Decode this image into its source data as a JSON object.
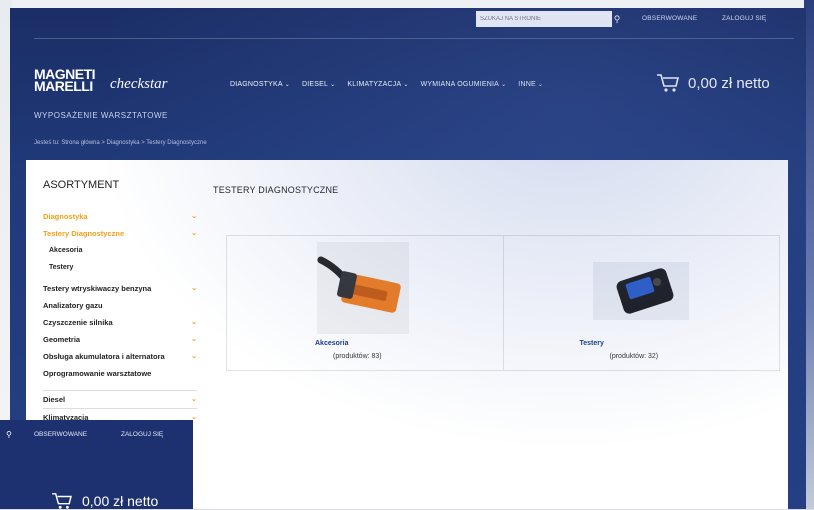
{
  "topbar": {
    "search_placeholder": "SZUKAJ NA STRONIE",
    "search_icon": "search-icon",
    "watched": "OBSERWOWANE",
    "login": "ZALOGUJ SIĘ"
  },
  "logo": {
    "line1": "MAGNETI",
    "line2": "MARELLI",
    "product": "checkstar"
  },
  "tagline": "WYPOSAŻENIE WARSZTATOWE",
  "nav": [
    {
      "label": "DIAGNOSTYKA"
    },
    {
      "label": "DIESEL"
    },
    {
      "label": "KLIMATYZACJA"
    },
    {
      "label": "WYMIANA OGUMIENIA"
    },
    {
      "label": "INNE"
    }
  ],
  "cart": {
    "icon": "cart-icon",
    "total": "0,00 zł netto"
  },
  "breadcrumb": "Jesteś tu: Strona główna > Diagnostyka > Testery Diagnostyczne",
  "sidebar": {
    "title": "ASORTYMENT",
    "items": [
      {
        "label": "Diagnostyka",
        "active": true
      },
      {
        "label": "Testery Diagnostyczne",
        "active": true
      },
      {
        "label": "Akcesoria",
        "sub": true
      },
      {
        "label": "Testery",
        "sub": true
      },
      {
        "label": "Testery wtryskiwaczy benzyna"
      },
      {
        "label": "Analizatory gazu"
      },
      {
        "label": "Czyszczenie silnika"
      },
      {
        "label": "Geometria"
      },
      {
        "label": "Obsługa akumulatora i alternatora"
      },
      {
        "label": "Oprogramowanie warsztatowe"
      },
      {
        "label": "Diesel"
      },
      {
        "label": "Klimatyzacja"
      }
    ]
  },
  "main": {
    "title": "TESTERY DIAGNOSTYCZNE",
    "tiles": [
      {
        "name": "Akcesoria",
        "count": "(produktów: 83)"
      },
      {
        "name": "Testery",
        "count": "(produktów: 32)"
      }
    ]
  },
  "overlay": {
    "watched": "OBSERWOWANE",
    "login": "ZALOGUJ SIĘ",
    "total": "0,00 zł netto"
  },
  "colors": {
    "header_bg": "#1b2e66",
    "accent": "#f0a11b",
    "link": "#1a3a8a"
  }
}
